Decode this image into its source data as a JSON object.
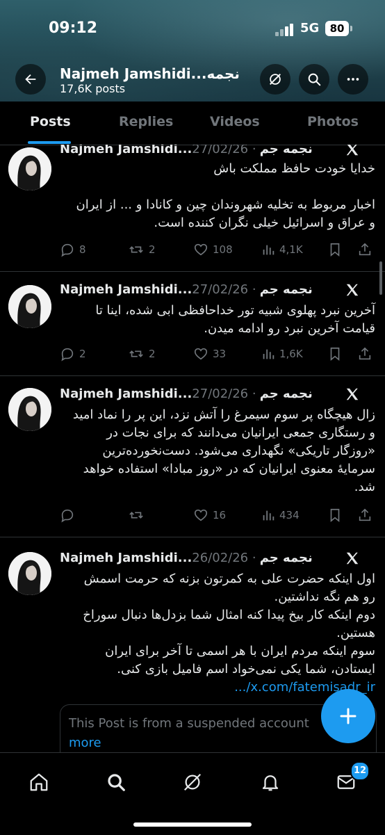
{
  "status_bar": {
    "time": "09:12",
    "network": "5G",
    "battery": "80"
  },
  "header": {
    "title": "Najmeh Jamshidi...نجمه",
    "subtitle": "17,6K posts"
  },
  "tabs": [
    {
      "label": "Posts",
      "active": true
    },
    {
      "label": "Replies",
      "active": false
    },
    {
      "label": "Videos",
      "active": false
    },
    {
      "label": "Photos",
      "active": false
    }
  ],
  "posts": [
    {
      "author": "Najmeh Jamshidi...نجمه جم",
      "date": "· 27/02/26",
      "text_lines": [
        "خدایا خودت حافظ مملکت باش",
        "",
        "اخبار مربوط به تخلیه شهروندان چین و کانادا و ... از ایران",
        "و عراق و اسرائیل خیلی نگران کننده است."
      ],
      "replies": "8",
      "reposts": "2",
      "likes": "108",
      "views": "4,1K"
    },
    {
      "author": "Najmeh Jamshidi...نجمه جم",
      "date": "· 27/02/26",
      "text_lines": [
        "آخرین نبرد پهلوی شبیه تور خداحافظی ابی شده، اینا تا",
        "قیامت آخرین نبرد رو ادامه میدن."
      ],
      "replies": "2",
      "reposts": "2",
      "likes": "33",
      "views": "1,6K"
    },
    {
      "author": "Najmeh Jamshidi...نجمه جم",
      "date": "· 27/02/26",
      "text_lines": [
        "زال هیچگاه پر سوم سیمرغ را آتش نزد، این پر را نماد امید",
        "و رستگاری جمعی ایرانیان می‌دانند که برای نجات در",
        "«روزگار تاریکی» نگهداری می‌شود.  دست‌نخورده‌ترین",
        "سرمایهٔ معنوی ایرانیان که در «روز مبادا» استفاده خواهد",
        "شد."
      ],
      "replies": "",
      "reposts": "",
      "likes": "16",
      "views": "434"
    },
    {
      "author": "Najmeh Jamshidi...نجمه جم",
      "date": "· 26/02/26",
      "text_lines": [
        "اول اینکه حضرت علی به کمرتون بزنه که حرمت اسمش",
        "رو هم نگه نداشتین.",
        "دوم اینکه کار بیخ پیدا کنه امثال شما بزدل‌ها دنبال سوراخ",
        "هستین.",
        "سوم اینکه مردم ایران با هر اسمی تا آخر برای ایران",
        "ایستادن، شما یکی نمی‌خواد اسم فامیل بازی کنی."
      ],
      "link": "x.com/fatemisadr_ir/...",
      "quote_text": "This Post is from a suspended account",
      "quote_more": "more"
    }
  ],
  "bottom_nav": {
    "messages_badge": "12"
  },
  "colors": {
    "accent": "#1d9bf0",
    "muted": "#71767b",
    "divider": "#2f3336"
  }
}
